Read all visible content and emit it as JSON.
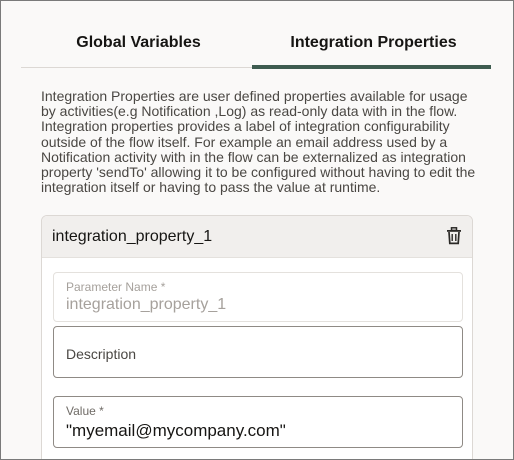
{
  "tabs": {
    "global_variables": "Global Variables",
    "integration_properties": "Integration Properties",
    "active": "integration_properties"
  },
  "description": "Integration Properties are user defined properties available for usage by activities(e.g Notification ,Log) as read-only data with in the flow. Integration properties provides a label of integration configurability outside of the flow itself. For example an email address used by a Notification activity with in the flow can be externalized as integration property 'sendTo' allowing it to be configured without having to edit the integration itself or having to pass the value at runtime.",
  "property_card": {
    "title": "integration_property_1",
    "delete_icon": "trash-icon",
    "parameter_name": {
      "label": "Parameter Name *",
      "value": "integration_property_1"
    },
    "description_field": {
      "placeholder": "Description"
    },
    "value_field": {
      "label": "Value *",
      "value": "\"myemail@mycompany.com\""
    }
  },
  "colors": {
    "active_tab_underline": "#3e5c50",
    "card_header_bg": "#f1efed",
    "page_bg": "#faf9f8"
  }
}
